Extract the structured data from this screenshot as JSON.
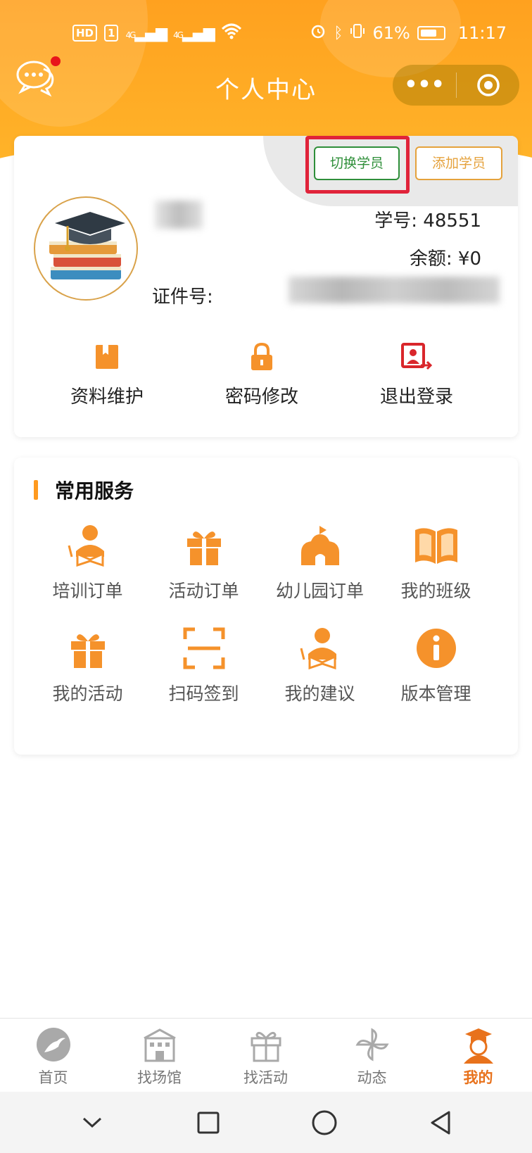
{
  "status_bar": {
    "hd": "HD",
    "sim": "1",
    "net1": "4G",
    "net2": "4G",
    "battery_pct": "61%",
    "time": "11:17"
  },
  "nav": {
    "title": "个人中心",
    "more_icon": "more-dots-icon",
    "close_icon": "target-circle-icon"
  },
  "profile": {
    "switch_label": "切换学员",
    "add_label": "添加学员",
    "student_no": "学号: 48551",
    "balance": "余额: ¥0",
    "id_label": "证件号:",
    "actions": [
      {
        "label": "资料维护",
        "icon": "bookmark-folder-icon"
      },
      {
        "label": "密码修改",
        "icon": "lock-icon"
      },
      {
        "label": "退出登录",
        "icon": "logout-icon"
      }
    ]
  },
  "services": {
    "title": "常用服务",
    "items": [
      {
        "label": "培训订单",
        "icon": "student-reading-icon"
      },
      {
        "label": "活动订单",
        "icon": "gift-icon"
      },
      {
        "label": "幼儿园订单",
        "icon": "school-house-icon"
      },
      {
        "label": "我的班级",
        "icon": "open-book-icon"
      },
      {
        "label": "我的活动",
        "icon": "gift-icon"
      },
      {
        "label": "扫码签到",
        "icon": "scan-frame-icon"
      },
      {
        "label": "我的建议",
        "icon": "student-reading-icon"
      },
      {
        "label": "版本管理",
        "icon": "info-icon"
      }
    ]
  },
  "tabs": [
    {
      "label": "首页",
      "icon": "home-logo-icon",
      "active": false
    },
    {
      "label": "找场馆",
      "icon": "building-icon",
      "active": false
    },
    {
      "label": "找活动",
      "icon": "gift-icon",
      "active": false
    },
    {
      "label": "动态",
      "icon": "pinwheel-icon",
      "active": false
    },
    {
      "label": "我的",
      "icon": "user-cap-icon",
      "active": true
    }
  ],
  "colors": {
    "brand_orange": "#ff9a1f",
    "switch_green": "#2f8f3a",
    "add_gold": "#e5a23c",
    "highlight_red": "#e0233a",
    "active_tab": "#e8721c"
  }
}
